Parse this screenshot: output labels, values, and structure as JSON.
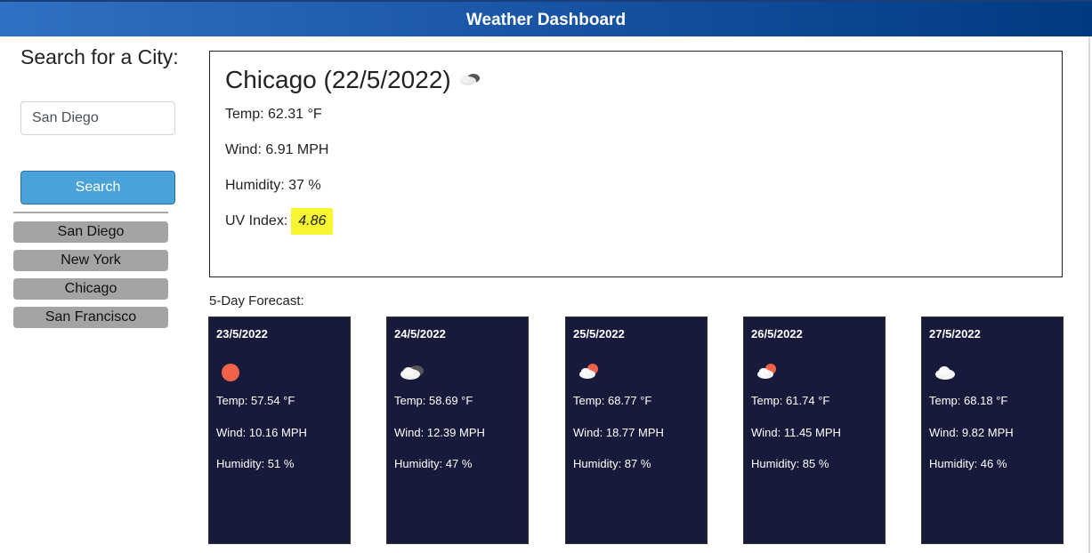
{
  "header": {
    "title": "Weather Dashboard"
  },
  "sidebar": {
    "search_title": "Search for a City:",
    "input_value": "San Diego",
    "search_button": "Search",
    "history": [
      "San Diego",
      "New York",
      "Chicago",
      "San Francisco"
    ]
  },
  "current": {
    "title": "Chicago (22/5/2022)",
    "icon": "clouds-icon",
    "temp": "Temp: 62.31 °F",
    "wind": "Wind: 6.91 MPH",
    "humidity": "Humidity: 37 %",
    "uv_label": "UV Index:",
    "uv_value": "4.86",
    "uv_color": "#f5f532"
  },
  "forecast": {
    "title": "5-Day Forecast:",
    "days": [
      {
        "date": "23/5/2022",
        "icon": "sun-icon",
        "temp": "Temp: 57.54 °F",
        "wind": "Wind: 10.16 MPH",
        "humidity": "Humidity: 51 %"
      },
      {
        "date": "24/5/2022",
        "icon": "clouds-icon",
        "temp": "Temp: 58.69 °F",
        "wind": "Wind: 12.39 MPH",
        "humidity": "Humidity: 47 %"
      },
      {
        "date": "25/5/2022",
        "icon": "sun-cloud-icon",
        "temp": "Temp: 68.77 °F",
        "wind": "Wind: 18.77 MPH",
        "humidity": "Humidity: 87 %"
      },
      {
        "date": "26/5/2022",
        "icon": "sun-cloud-icon",
        "temp": "Temp: 61.74 °F",
        "wind": "Wind: 11.45 MPH",
        "humidity": "Humidity: 85 %"
      },
      {
        "date": "27/5/2022",
        "icon": "cloud-icon",
        "temp": "Temp: 68.18 °F",
        "wind": "Wind: 9.82 MPH",
        "humidity": "Humidity: 46 %"
      }
    ]
  }
}
